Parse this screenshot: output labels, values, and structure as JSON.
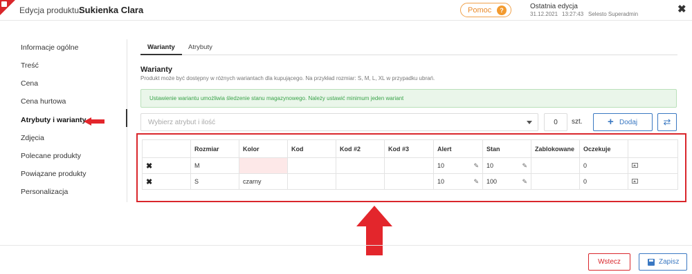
{
  "header": {
    "title_prefix": "Edycja produktu:",
    "product_name": "Sukienka Clara",
    "help_label": "Pomoc",
    "help_badge": "?",
    "last_edit_label": "Ostatnia edycja",
    "last_edit_date": "31.12.2021",
    "last_edit_time": "13:27:43",
    "last_edit_user": "Selesto Superadmin",
    "close_glyph": "✖"
  },
  "sidebar": {
    "items": [
      {
        "label": "Informacje ogólne"
      },
      {
        "label": "Treść"
      },
      {
        "label": "Cena"
      },
      {
        "label": "Cena hurtowa"
      },
      {
        "label": "Atrybuty i warianty",
        "active": true
      },
      {
        "label": "Zdjęcia"
      },
      {
        "label": "Polecane produkty"
      },
      {
        "label": "Powiązane produkty"
      },
      {
        "label": "Personalizacja"
      }
    ]
  },
  "tabs": [
    {
      "label": "Warianty",
      "active": true
    },
    {
      "label": "Atrybuty"
    }
  ],
  "section": {
    "title": "Warianty",
    "description": "Produkt może być dostępny w różnych wariantach dla kupującego. Na przykład rozmiar: S, M, L, XL w przypadku ubrań."
  },
  "alert": {
    "text": "Ustawienie wariantu umożliwia śledzenie stanu magazynowego. Należy ustawić minimum jeden wariant"
  },
  "controls": {
    "select_placeholder": "Wybierz atrybut i ilość",
    "quantity": "0",
    "unit": "szt.",
    "add_label": "Dodaj",
    "add_glyph": "+",
    "sync_glyph": "⇄"
  },
  "table": {
    "headers": [
      "",
      "Rozmiar",
      "Kolor",
      "Kod",
      "Kod #2",
      "Kod #3",
      "Alert",
      "Stan",
      "Zablokowane",
      "Oczekuje",
      ""
    ],
    "rows": [
      {
        "delete": "✖",
        "rozmiar": "M",
        "kolor": "",
        "kod": "",
        "kod2": "",
        "kod3": "",
        "alert": "10",
        "stan": "10",
        "zablokowane": "",
        "oczekuje": "0"
      },
      {
        "delete": "✖",
        "rozmiar": "S",
        "kolor": "czarny",
        "kod": "",
        "kod2": "",
        "kod3": "",
        "alert": "10",
        "stan": "100",
        "zablokowane": "",
        "oczekuje": "0"
      }
    ],
    "pencil_glyph": "✎"
  },
  "footer": {
    "back_label": "Wstecz",
    "save_label": "Zapisz"
  },
  "colors": {
    "accent_red": "#d9262b",
    "accent_blue": "#3a78c2",
    "help_orange": "#f39a2e",
    "alert_green": "#3aa34a"
  },
  "icons": [
    "close-icon",
    "help-icon",
    "delete-icon",
    "pencil-icon",
    "image-icon",
    "plus-icon",
    "sync-icon",
    "save-icon"
  ]
}
